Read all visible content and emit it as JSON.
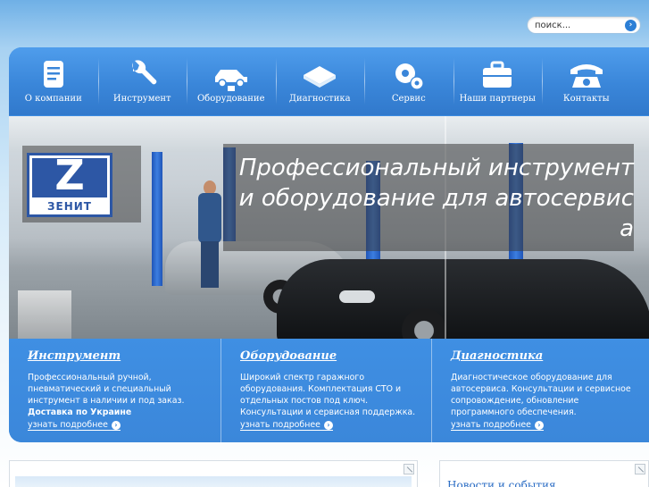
{
  "search": {
    "placeholder": "поиск..."
  },
  "nav": [
    {
      "label": "О компании",
      "icon": "document-icon"
    },
    {
      "label": "Инструмент",
      "icon": "wrench-icon"
    },
    {
      "label": "Оборудование",
      "icon": "car-lift-icon"
    },
    {
      "label": "Диагностика",
      "icon": "chip-icon"
    },
    {
      "label": "Сервис",
      "icon": "gears-icon"
    },
    {
      "label": "Наши партнеры",
      "icon": "briefcase-icon"
    },
    {
      "label": "Контакты",
      "icon": "phone-icon"
    }
  ],
  "banner": {
    "logo_letter": "Z",
    "logo_name": "ЗЕНИТ",
    "tagline": "Профессиональный инструмент и оборудование для автосервиса"
  },
  "columns": [
    {
      "title": "Инструмент",
      "text": "Профессиональный ручной, пневматический и специальный инструмент в наличии и под заказ.",
      "strong": "Доставка по Украине",
      "more": "узнать подробнее"
    },
    {
      "title": "Оборудование",
      "text": "Широкий спектр гаражного оборудования. Комплектация СТО и отдельных постов под ключ. Консультации и сервисная поддержка.",
      "strong": "",
      "more": "узнать подробнее"
    },
    {
      "title": "Диагностика",
      "text": "Диагностическое оборудование для автосервиса. Консультации и сервисное сопровождение, обновление программного обеспечения.",
      "strong": "",
      "more": "узнать подробнее"
    }
  ],
  "news": {
    "title": "Новости и события"
  },
  "colors": {
    "accent": "#3c8ce0",
    "logo_blue": "#2d57a5",
    "link": "#2a6cc4"
  }
}
